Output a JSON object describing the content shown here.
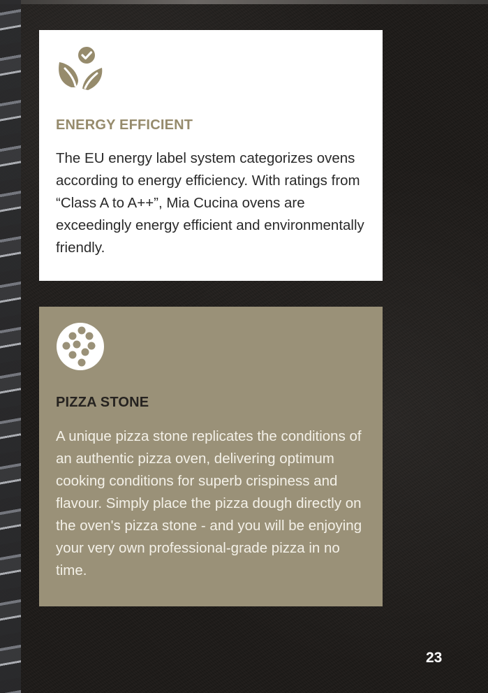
{
  "colors": {
    "background": "#1f1c1a",
    "energy_card_bg": "#ffffff",
    "energy_title": "#968b6c",
    "pizza_card_bg": "#9a9178",
    "pizza_title": "#262320",
    "pizza_text": "#f4f1e8",
    "icon_olive": "#968b6c"
  },
  "energy": {
    "icon": "leaf-check-icon",
    "title": "ENERGY EFFICIENT",
    "text": "The EU energy label system categorizes ovens according to energy efficiency. With ratings from “Class A to A++”, Mia Cucina ovens are exceedingly energy efficient and environmentally friendly."
  },
  "pizza": {
    "icon": "pizza-icon",
    "title": "PIZZA STONE",
    "text": "A unique pizza stone replicates the conditions of an authentic pizza oven, delivering optimum cooking conditions for superb crispiness and flavour. Simply place the pizza dough directly on the oven's pizza stone - and you will be enjoying your very own professional-grade pizza in no time."
  },
  "page_number": "23"
}
